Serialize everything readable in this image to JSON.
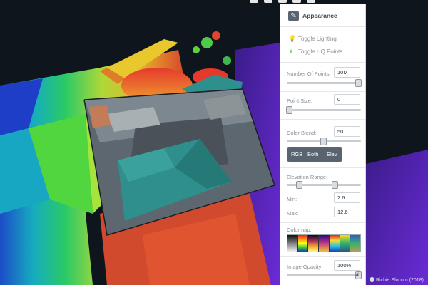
{
  "panel": {
    "title": "Appearance",
    "header_icon": "paintbrush-icon",
    "toggles": [
      {
        "label": "Toggle Lighting",
        "icon": "lightbulb-icon"
      },
      {
        "label": "Toggle HQ Points",
        "icon": "star-icon"
      }
    ],
    "num_points": {
      "label": "Number Of Points:",
      "value": "10M",
      "slider_fraction": 1.0
    },
    "point_size": {
      "label": "Point Size:",
      "value": "0",
      "slider_fraction": 0.0
    },
    "color_blend": {
      "label": "Color Blend:",
      "value": "50",
      "slider_fraction": 0.5,
      "buttons": [
        "RGB",
        "Both",
        "Elev"
      ]
    },
    "elevation_range": {
      "label": "Elevation Range:",
      "min_label": "Min:",
      "min_value": "2.6",
      "max_label": "Max:",
      "max_value": "12.6",
      "slider_min_fraction": 0.15,
      "slider_max_fraction": 0.65
    },
    "colormap": {
      "label": "Colormap:",
      "swatches": [
        "grayscale",
        "rainbow",
        "inferno",
        "plasma",
        "jet",
        "viridis",
        "earth"
      ]
    },
    "image_opacity": {
      "label": "Image Opacity:",
      "value": "100%",
      "slider_fraction": 1.0
    }
  },
  "credit": {
    "text": "Richie Slocum (2018)",
    "icon": "github-icon"
  },
  "colors": {
    "accent": "#5a6470",
    "panel_bg": "#ffffff",
    "background": "#111820",
    "roof_teal": "#2f8f8c"
  }
}
